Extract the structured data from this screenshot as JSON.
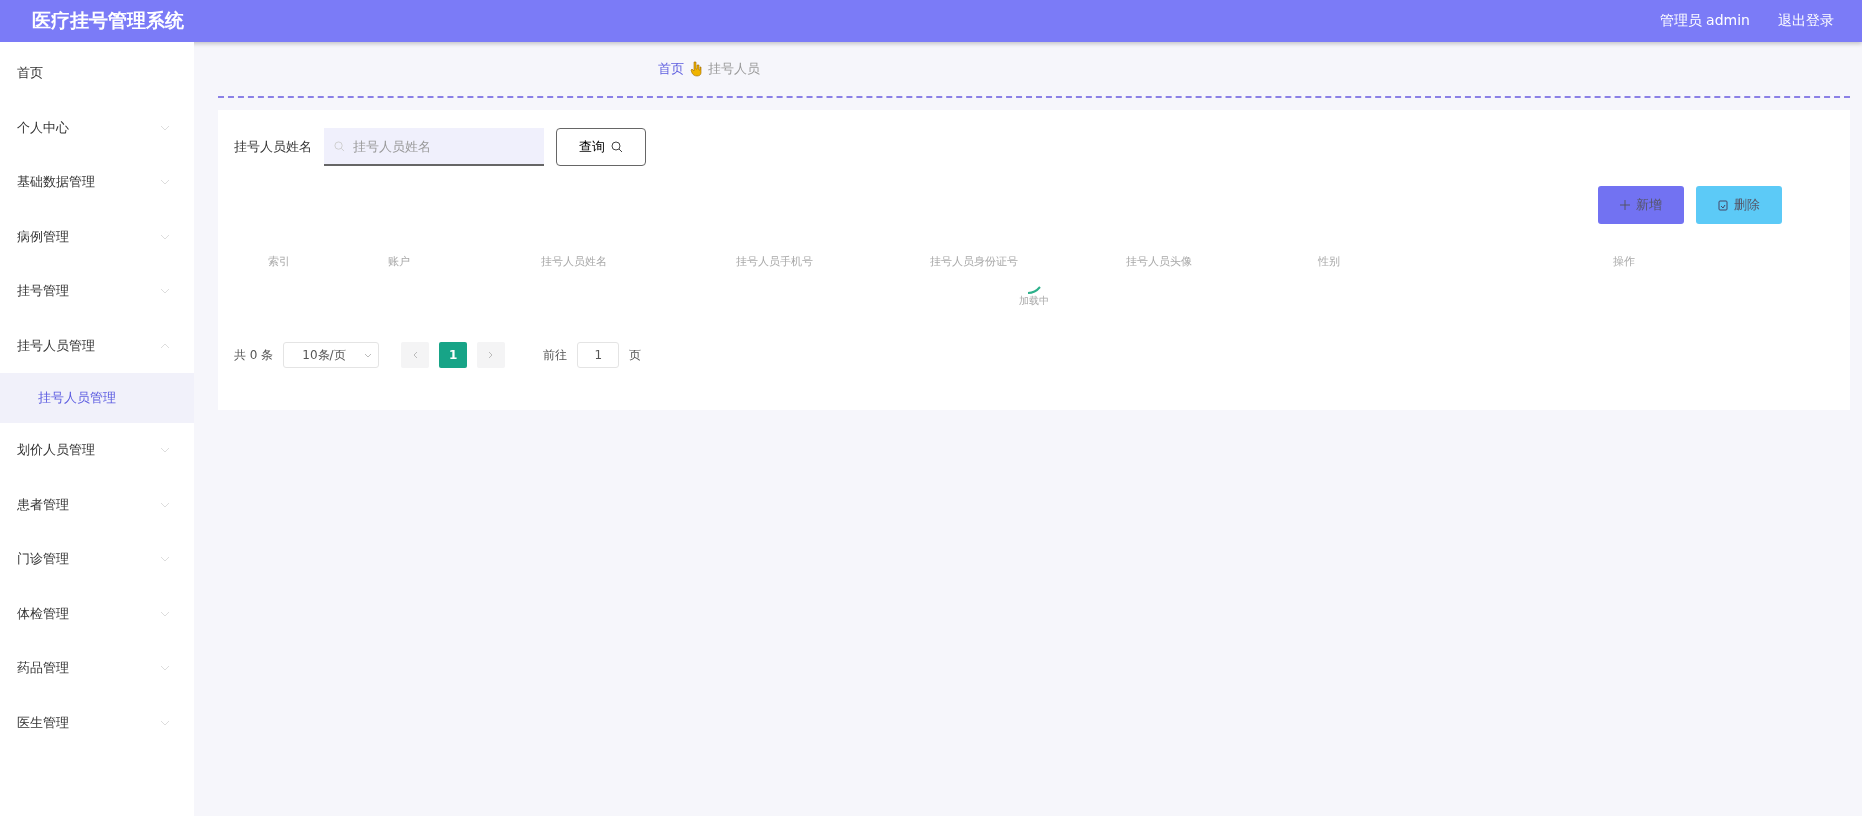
{
  "header": {
    "title": "医疗挂号管理系统",
    "user": "管理员 admin",
    "logout": "退出登录"
  },
  "sidebar": {
    "items": [
      {
        "label": "首页"
      },
      {
        "label": "个人中心",
        "expanded": false
      },
      {
        "label": "基础数据管理",
        "expanded": false
      },
      {
        "label": "病例管理",
        "expanded": false
      },
      {
        "label": "挂号管理",
        "expanded": false
      },
      {
        "label": "挂号人员管理",
        "expanded": true,
        "children": [
          {
            "label": "挂号人员管理",
            "selected": true
          }
        ]
      },
      {
        "label": "划价人员管理",
        "expanded": false
      },
      {
        "label": "患者管理",
        "expanded": false
      },
      {
        "label": "门诊管理",
        "expanded": false
      },
      {
        "label": "体检管理",
        "expanded": false
      },
      {
        "label": "药品管理",
        "expanded": false
      },
      {
        "label": "医生管理",
        "expanded": false
      }
    ]
  },
  "breadcrumb": [
    "首页",
    "挂号人员"
  ],
  "search": {
    "label": "挂号人员姓名",
    "placeholder": "挂号人员姓名",
    "button": "查询"
  },
  "actions": [
    {
      "kind": "add",
      "label": "新增"
    },
    {
      "kind": "delete",
      "label": "删除"
    }
  ],
  "table": {
    "columns": [
      "索引",
      "账户",
      "挂号人员姓名",
      "挂号人员手机号",
      "挂号人员身份证号",
      "挂号人员头像",
      "性别",
      "操作"
    ],
    "loading": "加载中"
  },
  "pagination": {
    "total": "共 0 条",
    "page_size": "10条/页",
    "pages": [
      {
        "label": "1",
        "selected": true
      }
    ],
    "goto_label": "前往",
    "goto_value": "1",
    "goto_suffix": "页"
  }
}
